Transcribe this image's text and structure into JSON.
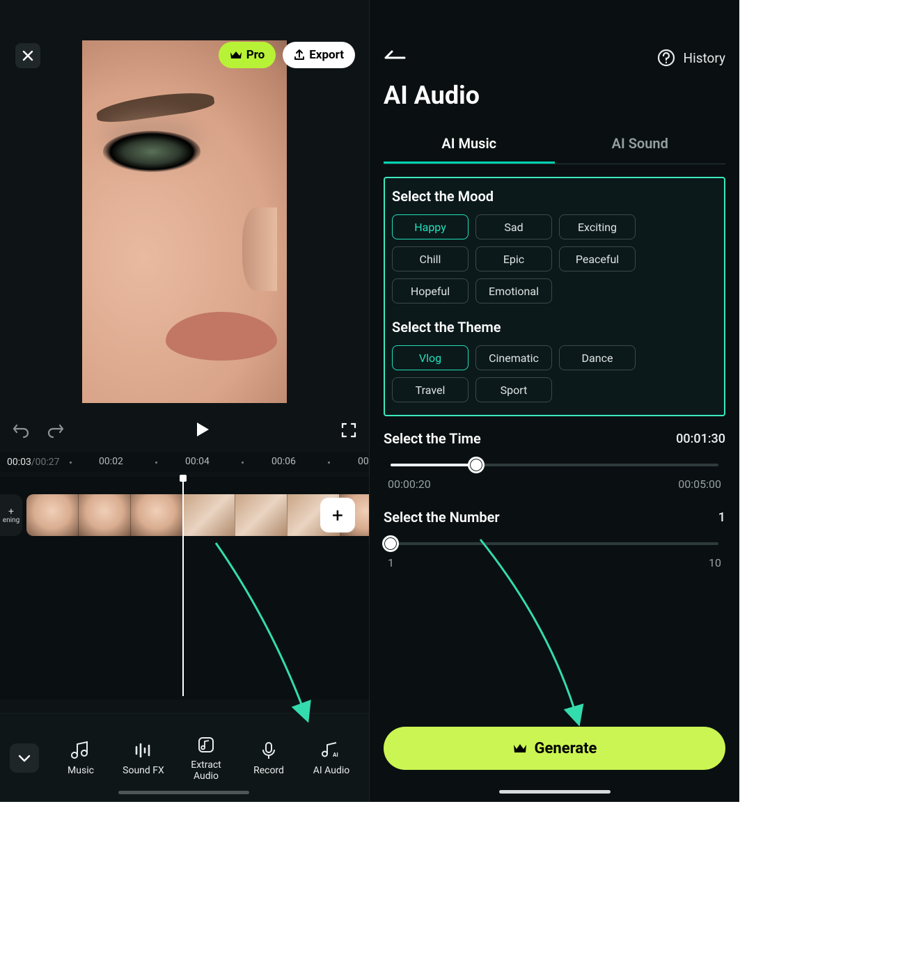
{
  "left": {
    "pro_label": "Pro",
    "export_label": "Export",
    "current_time": "00:03",
    "duration": "/00:27",
    "ticks": [
      "00:02",
      "00:04",
      "00:06",
      "00"
    ],
    "opening_label": "ening",
    "tools": {
      "music": "Music",
      "soundfx": "Sound FX",
      "extract": "Extract\nAudio",
      "record": "Record",
      "aiaudio": "AI Audio"
    }
  },
  "right": {
    "history_label": "History",
    "title": "AI Audio",
    "tabs": {
      "music": "AI Music",
      "sound": "AI Sound"
    },
    "mood_label": "Select the Mood",
    "moods": [
      "Happy",
      "Sad",
      "Exciting",
      "Chill",
      "Epic",
      "Peaceful",
      "Hopeful",
      "Emotional"
    ],
    "mood_selected": "Happy",
    "theme_label": "Select the Theme",
    "themes": [
      "Vlog",
      "Cinematic",
      "Dance",
      "Travel",
      "Sport"
    ],
    "theme_selected": "Vlog",
    "time_label": "Select the Time",
    "time_value": "00:01:30",
    "time_min": "00:00:20",
    "time_max": "00:05:00",
    "time_percent": 25,
    "number_label": "Select the Number",
    "number_value": "1",
    "number_min": "1",
    "number_max": "10",
    "number_percent": 0,
    "generate_label": "Generate"
  }
}
